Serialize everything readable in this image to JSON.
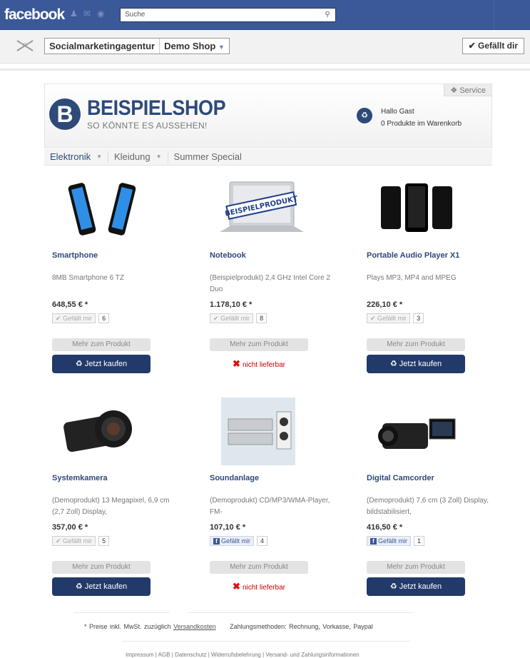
{
  "fb": {
    "logo": "facebook",
    "search_placeholder": "Suche"
  },
  "page": {
    "name": "Socialmarketingagentur",
    "tab": "Demo Shop",
    "like": "Gefällt dir"
  },
  "shop": {
    "name": "BEISPIELSHOP",
    "tagline": "SO KÖNNTE ES AUSSEHEN!",
    "service": "Service",
    "greeting": "Hallo Gast",
    "cart": "0 Produkte im Warenkorb"
  },
  "nav": [
    {
      "label": "Elektronik"
    },
    {
      "label": "Kleidung"
    },
    {
      "label": "Summer Special"
    }
  ],
  "products": [
    {
      "name": "Smartphone",
      "desc": "8MB Smartphone 6 TZ",
      "price": "648,55 € *",
      "like": "Gefällt mir",
      "count": "6",
      "more": "Mehr zum Produkt",
      "action": "Jetzt kaufen"
    },
    {
      "name": "Notebook",
      "desc": "(Beispielprodukt) 2,4 GHz Intel Core 2 Duo",
      "price": "1.178,10 € *",
      "like": "Gefällt mir",
      "count": "8",
      "more": "Mehr zum Produkt",
      "action": "nicht lieferbar",
      "stamp": "BEISPIELPRODUKT"
    },
    {
      "name": "Portable Audio Player X1",
      "desc": "Plays MP3, MP4 and MPEG",
      "price": "226,10 € *",
      "like": "Gefällt mir",
      "count": "3",
      "more": "Mehr zum Produkt",
      "action": "Jetzt kaufen"
    },
    {
      "name": "Systemkamera",
      "desc": "(Demoprodukt) 13 Megapixel, 6,9 cm (2,7 Zoll) Display,",
      "price": "357,00 € *",
      "like": "Gefällt mir",
      "count": "5",
      "more": "Mehr zum Produkt",
      "action": "Jetzt kaufen"
    },
    {
      "name": "Soundanlage",
      "desc": "(Demoprodukt) CD/MP3/WMA-Player, FM-",
      "price": "107,10 € *",
      "like": "Gefällt mir",
      "count": "4",
      "more": "Mehr zum Produkt",
      "action": "nicht lieferbar"
    },
    {
      "name": "Digital Camcorder",
      "desc": "(Demoprodukt) 7,6 cm (3 Zoll) Display, bildstabilisiert,",
      "price": "416,50 € *",
      "like": "Gefällt mir",
      "count": "1",
      "more": "Mehr zum Produkt",
      "action": "Jetzt kaufen"
    }
  ],
  "footer": {
    "prices": "* Preise inkl. MwSt. zuzüglich",
    "shipping": "Versandkosten",
    "payment": "Zahlungsmethoden: Rechnung, Vorkasse, Paypal",
    "links": "Impressum | AGB | Datenschutz | Widerrufsbelehrung | Versand- und Zahlungsinformationen"
  }
}
